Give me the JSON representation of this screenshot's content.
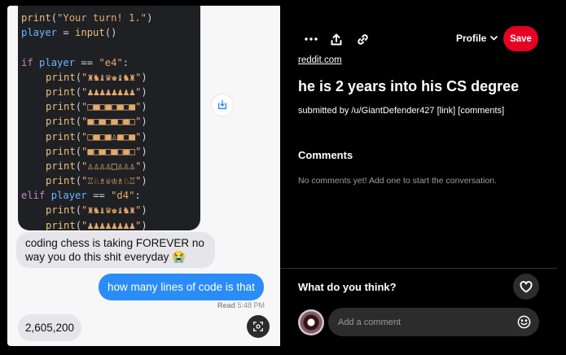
{
  "image": {
    "code_lines": [
      {
        "indent": 0,
        "parts": [
          {
            "c": "fn",
            "t": "print"
          },
          {
            "c": "pl",
            "t": "("
          },
          {
            "c": "st",
            "t": "\"Your turn! 1.\""
          },
          {
            "c": "pl",
            "t": ")"
          }
        ]
      },
      {
        "indent": 0,
        "parts": [
          {
            "c": "vr",
            "t": "player"
          },
          {
            "c": "pl",
            "t": " = "
          },
          {
            "c": "fn",
            "t": "input"
          },
          {
            "c": "pl",
            "t": "()"
          }
        ]
      },
      {
        "indent": 0,
        "parts": []
      },
      {
        "indent": 0,
        "parts": [
          {
            "c": "kw",
            "t": "if"
          },
          {
            "c": "pl",
            "t": " "
          },
          {
            "c": "vr",
            "t": "player"
          },
          {
            "c": "pl",
            "t": " == "
          },
          {
            "c": "st",
            "t": "\"e4\""
          },
          {
            "c": "pl",
            "t": ":"
          }
        ]
      },
      {
        "indent": 1,
        "parts": [
          {
            "c": "fn",
            "t": "print"
          },
          {
            "c": "pl",
            "t": "("
          },
          {
            "c": "st",
            "t": "\"♜♞♝♛♚♝♞♜\""
          },
          {
            "c": "pl",
            "t": ")"
          }
        ]
      },
      {
        "indent": 1,
        "parts": [
          {
            "c": "fn",
            "t": "print"
          },
          {
            "c": "pl",
            "t": "("
          },
          {
            "c": "st",
            "t": "\"♟♟♟♟♟♟♟♟\""
          },
          {
            "c": "pl",
            "t": ")"
          }
        ]
      },
      {
        "indent": 1,
        "parts": [
          {
            "c": "fn",
            "t": "print"
          },
          {
            "c": "pl",
            "t": "("
          },
          {
            "c": "st",
            "t": "\"□■□■□■□■\""
          },
          {
            "c": "pl",
            "t": ")"
          }
        ]
      },
      {
        "indent": 1,
        "parts": [
          {
            "c": "fn",
            "t": "print"
          },
          {
            "c": "pl",
            "t": "("
          },
          {
            "c": "st",
            "t": "\"■□■□■□■□\""
          },
          {
            "c": "pl",
            "t": ")"
          }
        ]
      },
      {
        "indent": 1,
        "parts": [
          {
            "c": "fn",
            "t": "print"
          },
          {
            "c": "pl",
            "t": "("
          },
          {
            "c": "st",
            "t": "\"□■□■♙■□■\""
          },
          {
            "c": "pl",
            "t": ")"
          }
        ]
      },
      {
        "indent": 1,
        "parts": [
          {
            "c": "fn",
            "t": "print"
          },
          {
            "c": "pl",
            "t": "("
          },
          {
            "c": "st",
            "t": "\"■□■□■□■□\""
          },
          {
            "c": "pl",
            "t": ")"
          }
        ]
      },
      {
        "indent": 1,
        "parts": [
          {
            "c": "fn",
            "t": "print"
          },
          {
            "c": "pl",
            "t": "("
          },
          {
            "c": "st",
            "t": "\"♙♙♙♙□♙♙♙\""
          },
          {
            "c": "pl",
            "t": ")"
          }
        ]
      },
      {
        "indent": 1,
        "parts": [
          {
            "c": "fn",
            "t": "print"
          },
          {
            "c": "pl",
            "t": "("
          },
          {
            "c": "st",
            "t": "\"♖♘♗♕♔♗♘♖\""
          },
          {
            "c": "pl",
            "t": ")"
          }
        ]
      },
      {
        "indent": 0,
        "parts": [
          {
            "c": "kw",
            "t": "elif"
          },
          {
            "c": "pl",
            "t": " "
          },
          {
            "c": "vr",
            "t": "player"
          },
          {
            "c": "pl",
            "t": " == "
          },
          {
            "c": "st",
            "t": "\"d4\""
          },
          {
            "c": "pl",
            "t": ":"
          }
        ]
      },
      {
        "indent": 1,
        "parts": [
          {
            "c": "fn",
            "t": "print"
          },
          {
            "c": "pl",
            "t": "("
          },
          {
            "c": "st",
            "t": "\"♜♞♝♛♚♝♞♜\""
          },
          {
            "c": "pl",
            "t": ")"
          }
        ]
      },
      {
        "indent": 1,
        "parts": [
          {
            "c": "fn",
            "t": "print"
          },
          {
            "c": "pl",
            "t": "("
          },
          {
            "c": "st",
            "t": "\"♟♟♟♟♟♟♟♟\""
          },
          {
            "c": "pl",
            "t": ")"
          }
        ]
      }
    ],
    "message_1": "coding chess is taking FOREVER no way you do this shit everyday 😭",
    "message_2": "how many lines of code is that",
    "read_label": "Read",
    "read_time": "5:48 PM",
    "message_3": "2,605,200"
  },
  "toolbar": {
    "more_icon": "more-horizontal-icon",
    "share_icon": "upload-share-icon",
    "link_icon": "link-icon",
    "profile_label": "Profile",
    "save_label": "Save"
  },
  "pin": {
    "domain": "reddit.com",
    "title": "he is 2 years into his CS degree",
    "submitted": "submitted by /u/GiantDefender427 [link] [comments]"
  },
  "comments": {
    "heading": "Comments",
    "empty_text": "No comments yet! Add one to start the conversation."
  },
  "footer": {
    "prompt": "What do you think?",
    "comment_placeholder": "Add a comment"
  },
  "colors": {
    "save": "#e60023",
    "imessage_blue": "#2a8cf7"
  }
}
